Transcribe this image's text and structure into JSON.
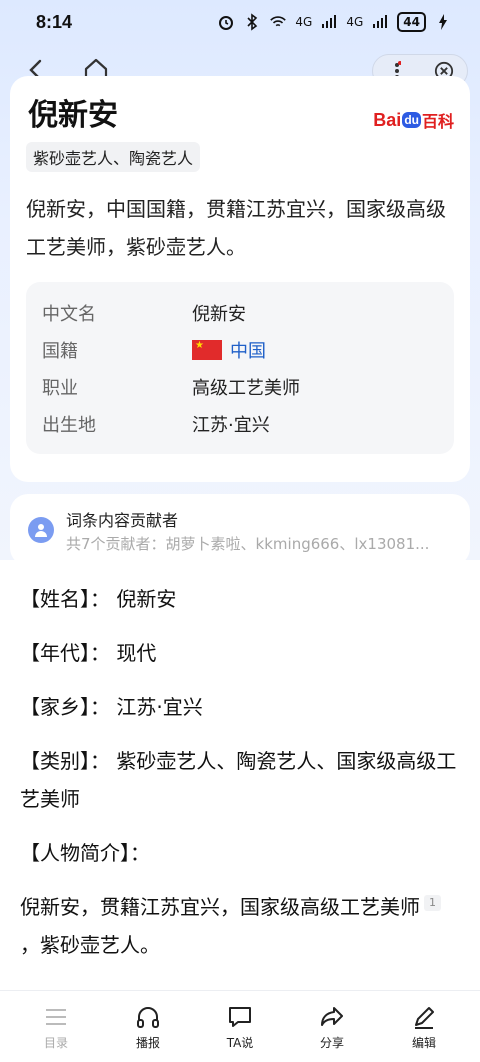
{
  "status_bar": {
    "time": "8:14",
    "network_1": "4G",
    "network_2": "4G",
    "battery": "44"
  },
  "entry": {
    "title": "倪新安",
    "tag": "紫砂壶艺人、陶瓷艺人",
    "logo_text_1": "Bai",
    "logo_text_2": "du",
    "logo_text_3": "百科",
    "summary": "倪新安，中国国籍，贯籍江苏宜兴，国家级高级工艺美师，紫砂壶艺人。"
  },
  "info_box": [
    {
      "label": "中文名",
      "value": "倪新安"
    },
    {
      "label": "国籍",
      "value": "中国"
    },
    {
      "label": "职业",
      "value": "高级工艺美师"
    },
    {
      "label": "出生地",
      "value": "江苏·宜兴"
    }
  ],
  "contributors": {
    "title": "词条内容贡献者",
    "subtitle": "共7个贡献者：胡萝卜素啦、kkming666、lx13081..."
  },
  "body": {
    "name_line": "【姓名】：  倪新安",
    "era_line": "【年代】：  现代",
    "hometown_line": "【家乡】：  江苏·宜兴",
    "category_line": "【类别】：  紫砂壶艺人、陶瓷艺人、国家级高级工艺美师",
    "intro_heading": "【人物简介】：",
    "intro_part1": "倪新安，贯籍江苏宜兴，国家级高级工艺美师",
    "ref_mark": "1",
    "intro_part2": "，紫砂壶艺人。"
  },
  "bottom_nav": [
    {
      "label": "目录",
      "icon": "list-icon"
    },
    {
      "label": "播报",
      "icon": "headphones-icon"
    },
    {
      "label": "TA说",
      "icon": "chat-icon"
    },
    {
      "label": "分享",
      "icon": "share-icon"
    },
    {
      "label": "编辑",
      "icon": "edit-icon"
    }
  ],
  "colors": {
    "accent_blue": "#2060c8",
    "brand_red": "#e02020",
    "brand_blue": "#2d5be3"
  }
}
